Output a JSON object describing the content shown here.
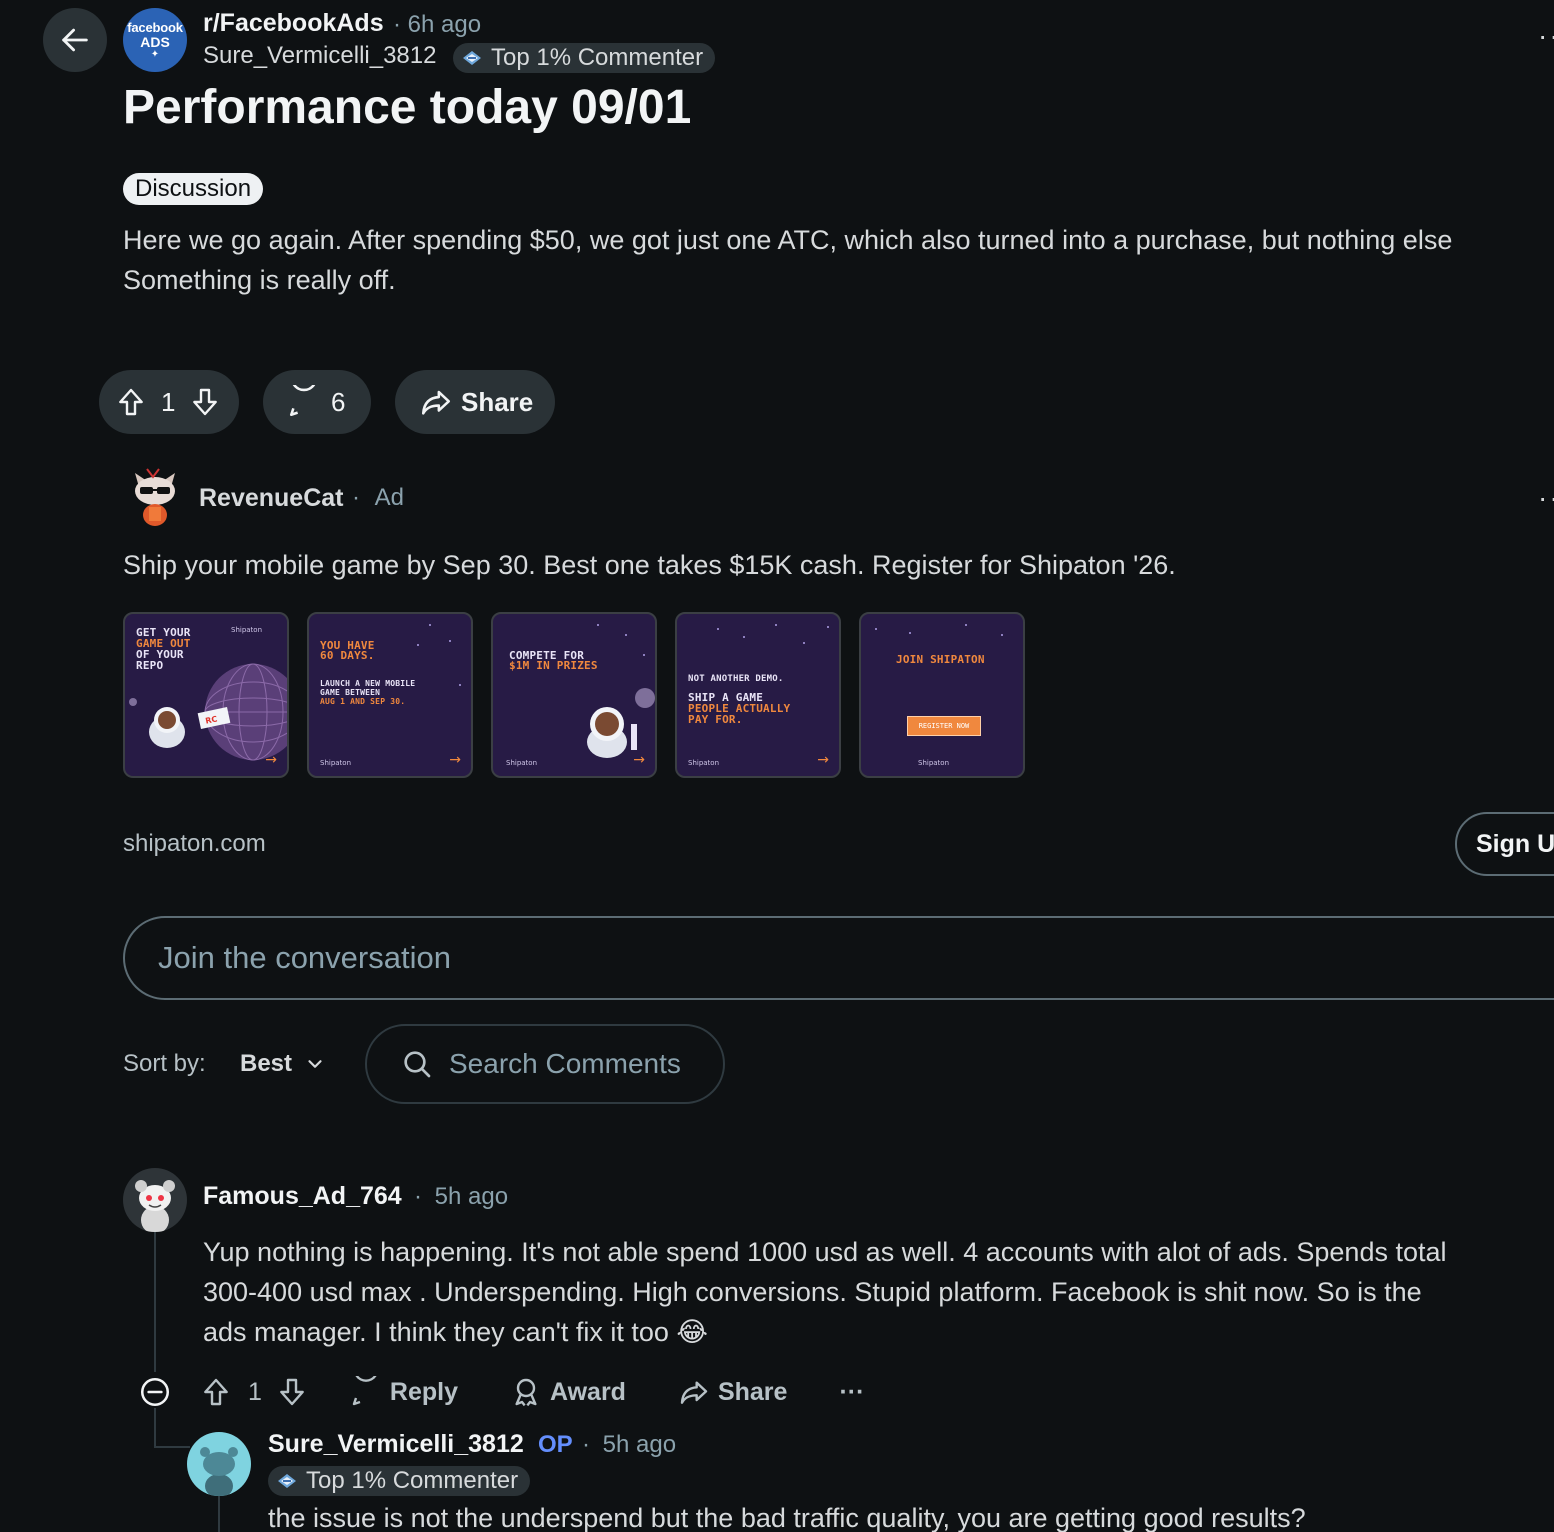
{
  "post": {
    "subreddit": "r/FacebookAds",
    "subreddit_avatar_top": "facebook",
    "subreddit_avatar_bottom": "ADS",
    "time": "6h ago",
    "author": "Sure_Vermicelli_3812",
    "author_flair": "Top 1% Commenter",
    "title": "Performance today 09/01",
    "tag": "Discussion",
    "body_line1": "Here we go again. After spending $50, we got just one ATC, which also turned into a purchase, but nothing else",
    "body_line2": "Something is really off.",
    "upvotes": "1",
    "comments_count": "6",
    "share_label": "Share"
  },
  "ad": {
    "advertiser": "RevenueCat",
    "label": "Ad",
    "text": "Ship your mobile game by Sep 30. Best one takes $15K cash. Register for Shipaton '26.",
    "domain": "shipaton.com",
    "cta": "Sign Up",
    "cards": [
      {
        "line1": "GET YOUR",
        "line2": "GAME OUT",
        "line3": "OF YOUR",
        "line4": "REPO",
        "brand": "Shipaton"
      },
      {
        "line1": "YOU HAVE",
        "line2": "60 DAYS.",
        "line3": "LAUNCH A NEW MOBILE",
        "line4": "GAME BETWEEN",
        "line5": "AUG 1 AND SEP 30.",
        "brand": "Shipaton"
      },
      {
        "line1": "COMPETE FOR",
        "line2": "$1M IN PRIZES",
        "brand": "Shipaton"
      },
      {
        "line1": "NOT ANOTHER DEMO.",
        "line2": "SHIP A GAME",
        "line3": "PEOPLE ACTUALLY",
        "line4": "PAY FOR.",
        "brand": "Shipaton"
      },
      {
        "line1": "JOIN SHIPATON",
        "button": "REGISTER NOW",
        "brand": "Shipaton"
      }
    ]
  },
  "composer": {
    "placeholder": "Join the conversation"
  },
  "sort": {
    "label": "Sort by:",
    "value": "Best",
    "search_placeholder": "Search Comments"
  },
  "comments": [
    {
      "author": "Famous_Ad_764",
      "time": "5h ago",
      "line1": "Yup nothing is happening. It's not able spend 1000 usd as well. 4 accounts with alot of ads. Spends total",
      "line2": "300-400 usd max . Underspending. High conversions. Stupid platform. Facebook is shit now. So is the",
      "line3": "ads manager. I think they can't fix it too 😂",
      "upvotes": "1",
      "reply_label": "Reply",
      "award_label": "Award",
      "share_label": "Share",
      "more": "···"
    },
    {
      "author": "Sure_Vermicelli_3812",
      "op_badge": "OP",
      "time": "5h ago",
      "flair": "Top 1% Commenter",
      "text": "the issue is not the underspend but the bad traffic quality, you are getting good results?"
    }
  ],
  "colors": {
    "background": "#0e1113",
    "pill": "#2a3236",
    "muted": "#8ba2ad",
    "op": "#648efc",
    "accent_orange": "#f0883e"
  }
}
